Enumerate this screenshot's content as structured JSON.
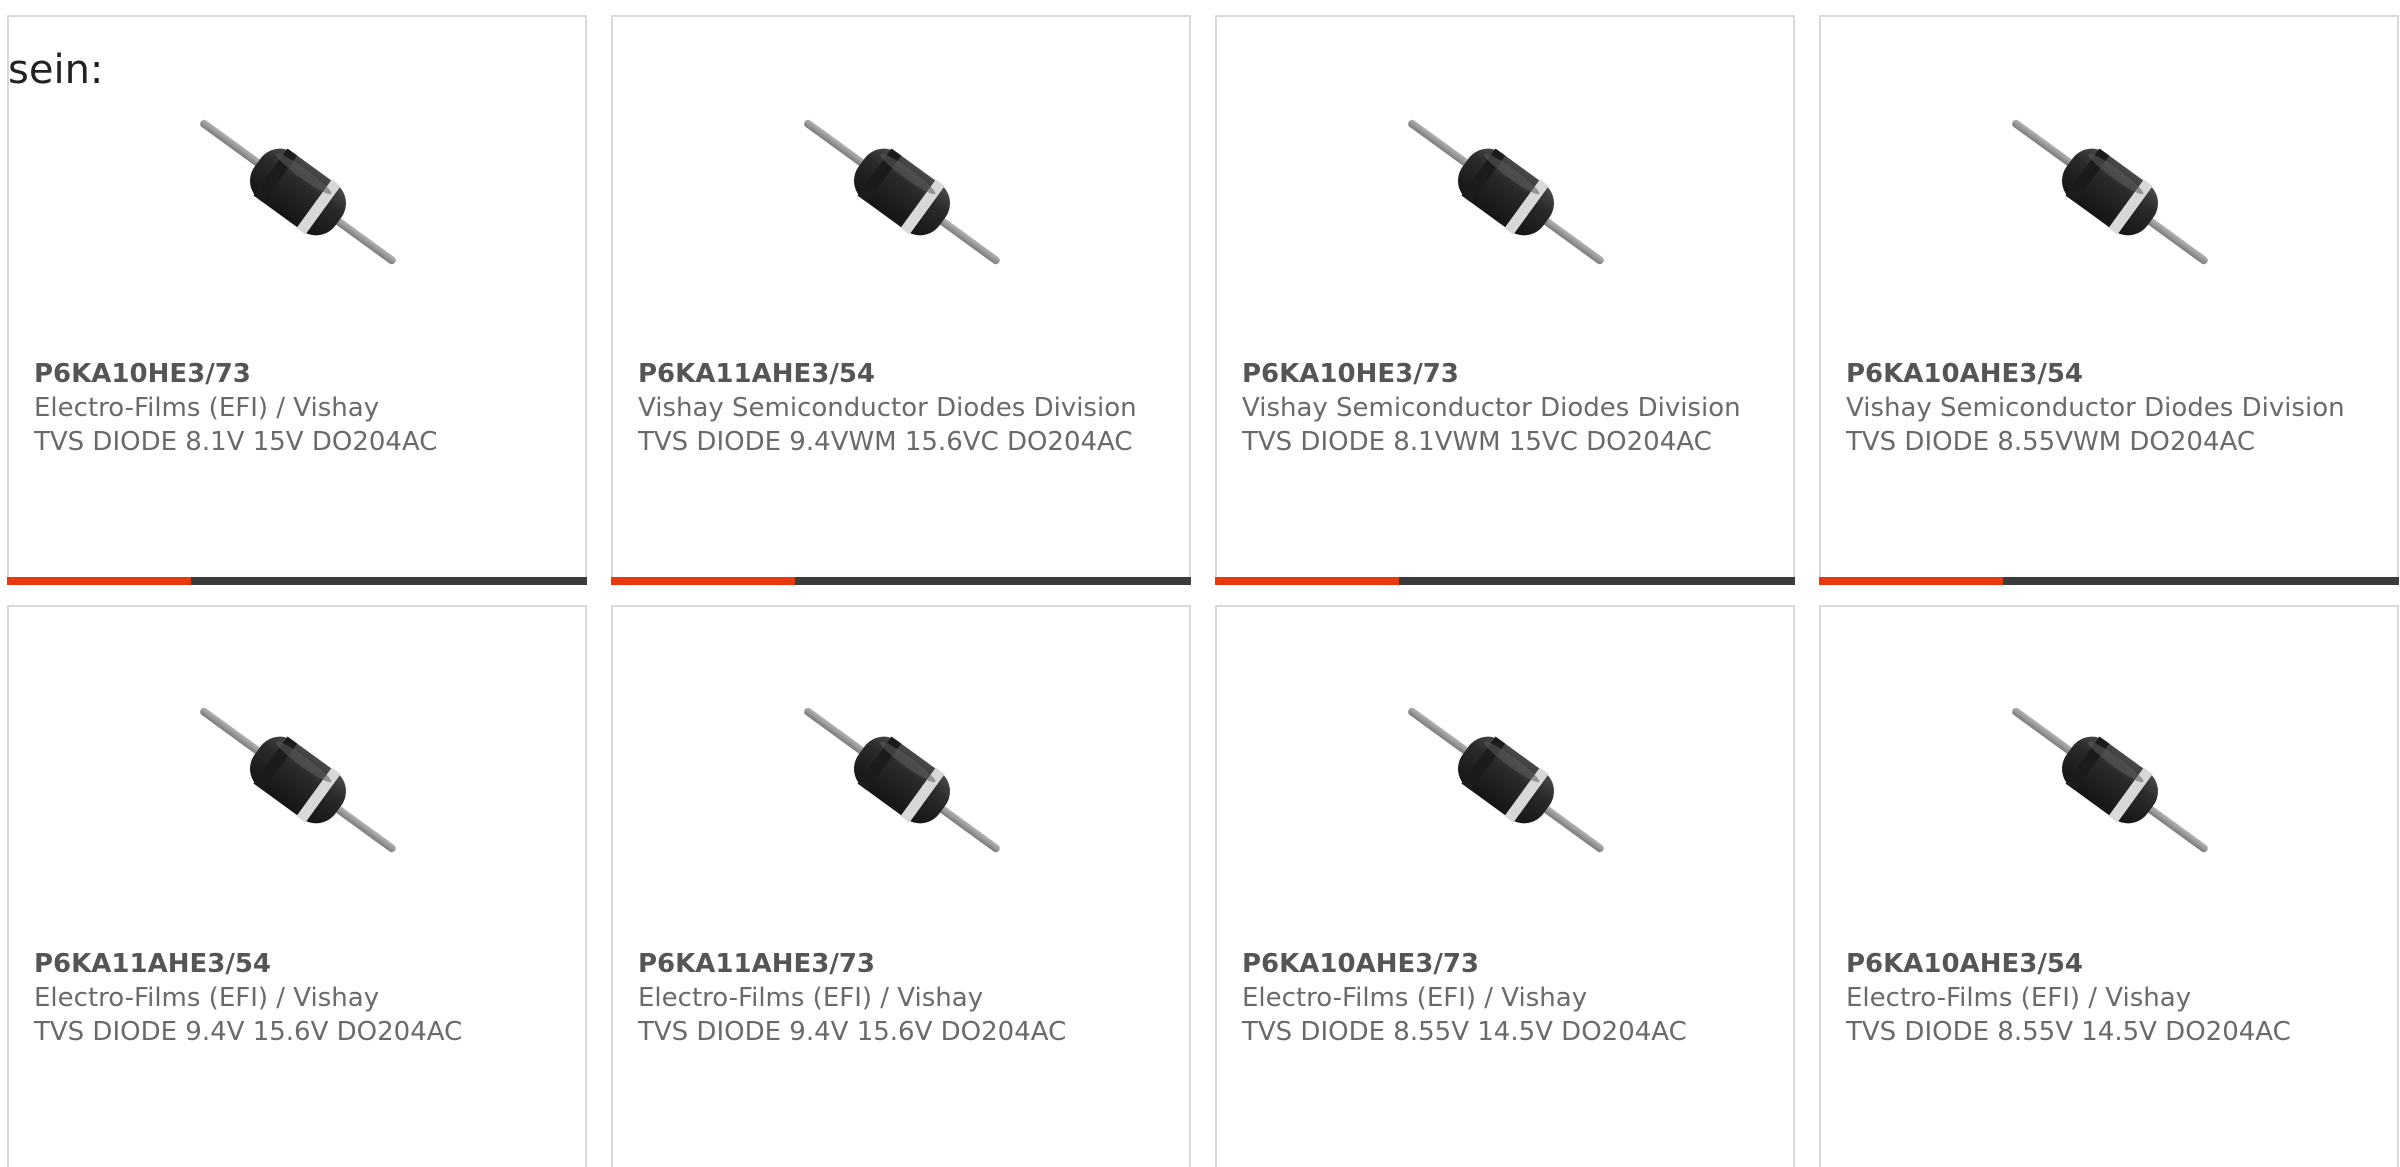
{
  "intro": {
    "text": "sein:"
  },
  "colors": {
    "accent": "#e63a0e",
    "bar": "#3b3b3b",
    "border": "#d9d9d9",
    "text": "#6a6a6a"
  },
  "products": [
    {
      "part_number": "P6KA10HE3/73",
      "manufacturer": "Electro-Films (EFI) / Vishay",
      "description": "TVS DIODE 8.1V 15V DO204AC",
      "image_icon": "axial-diode-image"
    },
    {
      "part_number": "P6KA11AHE3/54",
      "manufacturer": "Vishay Semiconductor Diodes Division",
      "description": "TVS DIODE 9.4VWM 15.6VC DO204AC",
      "image_icon": "axial-diode-image"
    },
    {
      "part_number": "P6KA10HE3/73",
      "manufacturer": "Vishay Semiconductor Diodes Division",
      "description": "TVS DIODE 8.1VWM 15VC DO204AC",
      "image_icon": "axial-diode-image"
    },
    {
      "part_number": "P6KA10AHE3/54",
      "manufacturer": "Vishay Semiconductor Diodes Division",
      "description": "TVS DIODE 8.55VWM DO204AC",
      "image_icon": "axial-diode-image"
    },
    {
      "part_number": "P6KA11AHE3/54",
      "manufacturer": "Electro-Films (EFI) / Vishay",
      "description": "TVS DIODE 9.4V 15.6V DO204AC",
      "image_icon": "axial-diode-image"
    },
    {
      "part_number": "P6KA11AHE3/73",
      "manufacturer": "Electro-Films (EFI) / Vishay",
      "description": "TVS DIODE 9.4V 15.6V DO204AC",
      "image_icon": "axial-diode-image"
    },
    {
      "part_number": "P6KA10AHE3/73",
      "manufacturer": "Electro-Films (EFI) / Vishay",
      "description": "TVS DIODE 8.55V 14.5V DO204AC",
      "image_icon": "axial-diode-image"
    },
    {
      "part_number": "P6KA10AHE3/54",
      "manufacturer": "Electro-Films (EFI) / Vishay",
      "description": "TVS DIODE 8.55V 14.5V DO204AC",
      "image_icon": "axial-diode-image"
    }
  ]
}
